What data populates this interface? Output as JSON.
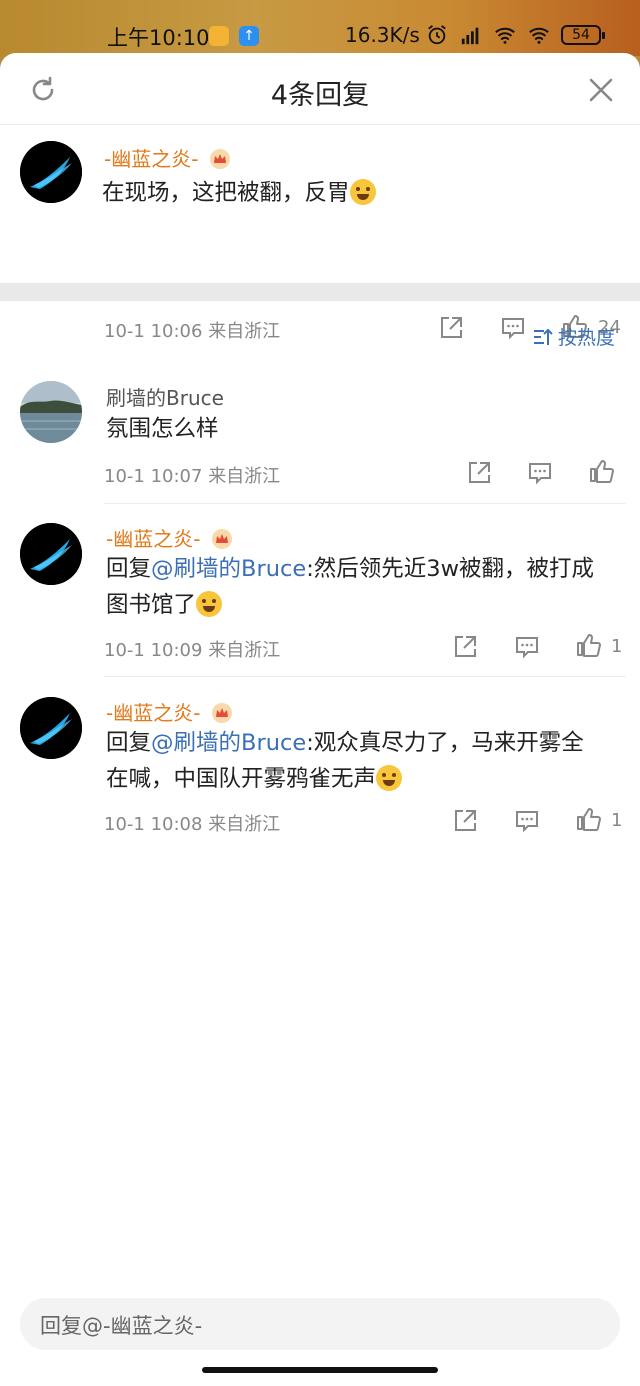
{
  "status_bar": {
    "time": "上午10:10",
    "speed": "16.3K/s",
    "battery": "54"
  },
  "header": {
    "title": "4条回复"
  },
  "main_comment": {
    "username": "-幽蓝之炎-",
    "text": "在现场，这把被翻，反胃",
    "time": "10-1 10:06",
    "location": "来自浙江",
    "likes": "24"
  },
  "sort": {
    "label": "按热度"
  },
  "replies": [
    {
      "username": "刷墙的Bruce",
      "text": "氛围怎么样",
      "time": "10-1 10:07",
      "location": "来自浙江",
      "likes": ""
    },
    {
      "username": "-幽蓝之炎-",
      "reply_prefix": "回复",
      "mention": "@刷墙的Bruce",
      "text_line1": ":然后领先近3w被翻，被打成",
      "text_line2": "图书馆了",
      "time": "10-1 10:09",
      "location": "来自浙江",
      "likes": "1"
    },
    {
      "username": "-幽蓝之炎-",
      "reply_prefix": "回复",
      "mention": "@刷墙的Bruce",
      "text_line1": ":观众真尽力了，马来开雾全",
      "text_line2": "在喊，中国队开雾鸦雀无声",
      "time": "10-1 10:08",
      "location": "来自浙江",
      "likes": "1"
    }
  ],
  "reply_input": {
    "placeholder": "回复@-幽蓝之炎-"
  },
  "colors": {
    "accent_blue": "#3b6fb6",
    "username_orange": "#e07a1b"
  }
}
